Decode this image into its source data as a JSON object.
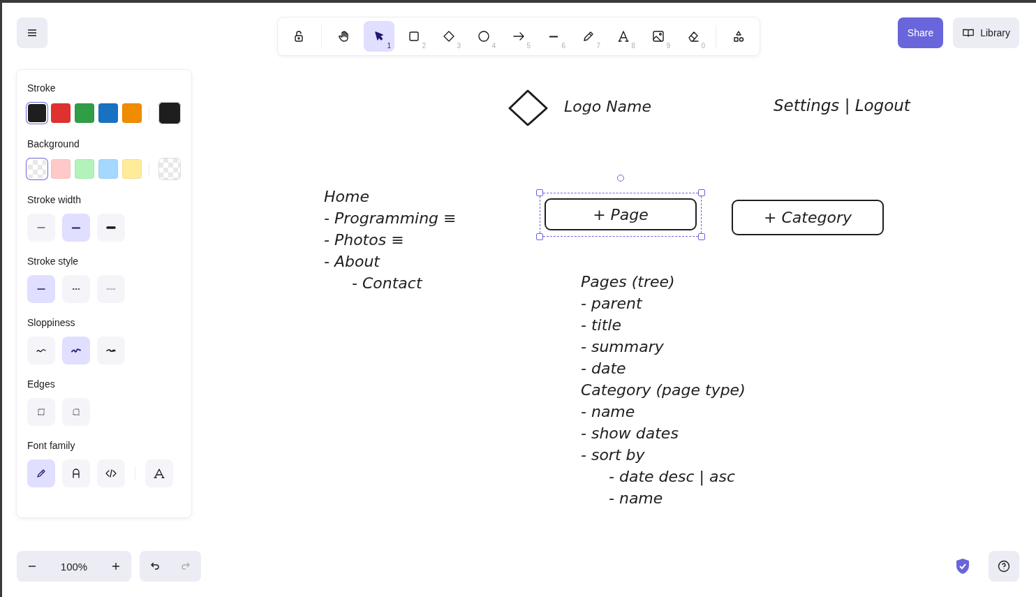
{
  "toolbar": {
    "tools": [
      {
        "kind": "lock",
        "selected": false
      },
      {
        "kind": "hand",
        "selected": false
      },
      {
        "kind": "select",
        "key": "1",
        "selected": true
      },
      {
        "kind": "rectangle",
        "key": "2",
        "selected": false
      },
      {
        "kind": "diamond",
        "key": "3",
        "selected": false
      },
      {
        "kind": "ellipse",
        "key": "4",
        "selected": false
      },
      {
        "kind": "arrow",
        "key": "5",
        "selected": false
      },
      {
        "kind": "line",
        "key": "6",
        "selected": false
      },
      {
        "kind": "draw",
        "key": "7",
        "selected": false
      },
      {
        "kind": "text",
        "key": "8",
        "selected": false
      },
      {
        "kind": "image",
        "key": "9",
        "selected": false
      },
      {
        "kind": "eraser",
        "key": "0",
        "selected": false
      },
      {
        "kind": "shapes",
        "selected": false
      }
    ]
  },
  "share_button": "Share",
  "library_button": "Library",
  "properties": {
    "stroke": {
      "label": "Stroke",
      "swatches": [
        {
          "color": "#1e1e1e",
          "selected": true
        },
        {
          "color": "#e03131",
          "selected": false
        },
        {
          "color": "#2f9e44",
          "selected": false
        },
        {
          "color": "#1971c2",
          "selected": false
        },
        {
          "color": "#f08c00",
          "selected": false
        }
      ]
    },
    "background": {
      "label": "Background",
      "swatches": [
        {
          "kind": "transparent",
          "selected": true
        },
        {
          "kind": "fill",
          "color": "#ffc9c9",
          "selected": false
        },
        {
          "kind": "fill",
          "color": "#b2f2bb",
          "selected": false
        },
        {
          "kind": "fill",
          "color": "#a5d8ff",
          "selected": false
        },
        {
          "kind": "fill",
          "color": "#ffec99",
          "selected": false
        }
      ]
    },
    "stroke_width": {
      "label": "Stroke width",
      "options": [
        {
          "kind": "thin",
          "selected": false
        },
        {
          "kind": "bold",
          "selected": true
        },
        {
          "kind": "extra-bold",
          "selected": false
        }
      ]
    },
    "stroke_style": {
      "label": "Stroke style",
      "options": [
        {
          "kind": "solid",
          "selected": true
        },
        {
          "kind": "dashed",
          "selected": false
        },
        {
          "kind": "dotted",
          "selected": false
        }
      ]
    },
    "sloppiness": {
      "label": "Sloppiness",
      "options": [
        {
          "kind": "architect",
          "selected": false
        },
        {
          "kind": "artist",
          "selected": true
        },
        {
          "kind": "cartoonist",
          "selected": false
        }
      ]
    },
    "edges": {
      "label": "Edges",
      "options": [
        {
          "kind": "sharp",
          "selected": false
        },
        {
          "kind": "round",
          "selected": false
        }
      ]
    },
    "font_family": {
      "label": "Font family",
      "options": [
        {
          "kind": "hand",
          "selected": true
        },
        {
          "kind": "normal",
          "selected": false
        },
        {
          "kind": "code",
          "selected": false
        },
        {
          "kind": "more",
          "selected": false
        }
      ]
    }
  },
  "zoom": {
    "level_text": "100%"
  },
  "history": {
    "undo_disabled": false,
    "redo_disabled": true
  },
  "canvas": {
    "logo_text": "Logo Name",
    "header_links": "Settings | Logout",
    "nav": [
      {
        "text": "Home"
      },
      {
        "text": "- Programming ≡"
      },
      {
        "text": "- Photos ≡"
      },
      {
        "text": "- About",
        "children": [
          {
            "text": "- Contact"
          }
        ]
      }
    ],
    "buttons": [
      {
        "label": "+ Page",
        "selected": true
      },
      {
        "label": "+ Category",
        "selected": false
      }
    ],
    "schema": [
      {
        "text": "Pages (tree)"
      },
      {
        "text": "- parent"
      },
      {
        "text": "- title"
      },
      {
        "text": "- summary"
      },
      {
        "text": "- date"
      },
      {
        "text": "Category (page type)"
      },
      {
        "text": "- name"
      },
      {
        "text": "- show dates"
      },
      {
        "text": "- sort by",
        "children": [
          {
            "text": "- date desc | asc"
          },
          {
            "text": "- name"
          }
        ]
      }
    ]
  }
}
